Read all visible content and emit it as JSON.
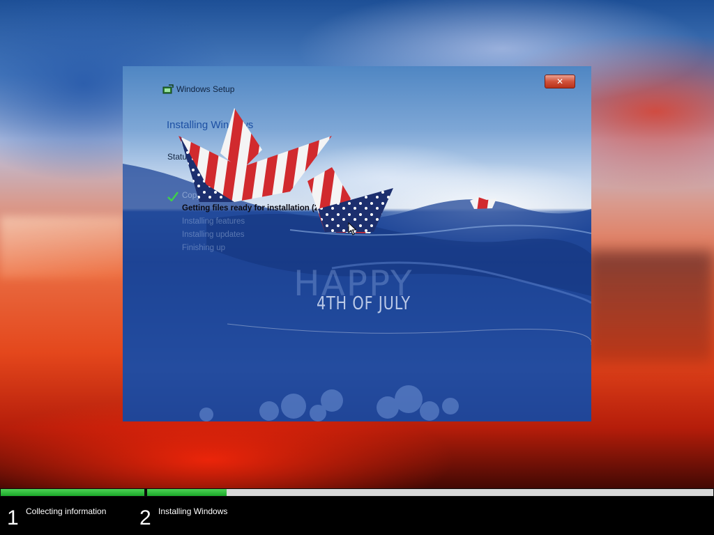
{
  "window": {
    "title": "Windows Setup",
    "page_title": "Installing Windows",
    "status_label": "Status",
    "close_label": "✕"
  },
  "steps": [
    {
      "label": "Copying Windows files",
      "state": "done"
    },
    {
      "label": "Getting files ready for installation (24%)",
      "state": "active"
    },
    {
      "label": "Installing features",
      "state": "pending"
    },
    {
      "label": "Installing updates",
      "state": "pending"
    },
    {
      "label": "Finishing up",
      "state": "pending"
    }
  ],
  "wallpaper": {
    "happy": "HAPPY",
    "july": "4TH OF JULY"
  },
  "progress": {
    "stages": [
      {
        "number": "1",
        "label": "Collecting information",
        "fill": 1.0
      },
      {
        "number": "2",
        "label": "Installing Windows",
        "fill": 0.14
      }
    ],
    "accent": "#1ca82a"
  },
  "icons": {
    "close": "close-icon",
    "setup": "windows-setup-icon",
    "check": "checkmark-icon",
    "cursor": "mouse-pointer-icon"
  }
}
